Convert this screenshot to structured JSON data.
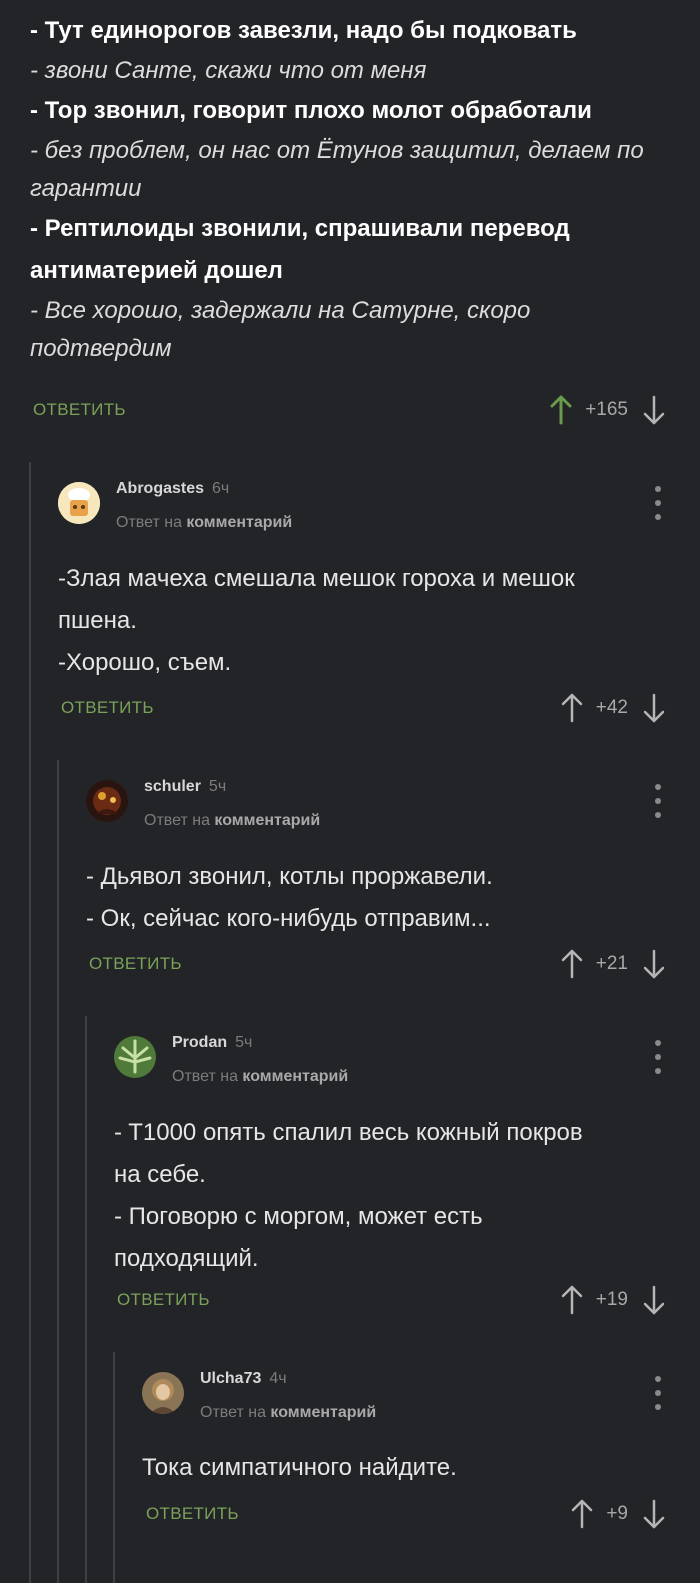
{
  "top_comment": {
    "lines": [
      {
        "text": "- Тут единорогов завезли, надо бы подковать",
        "style": "bold"
      },
      {
        "text": "- звони Санте, скажи что от меня",
        "style": "italic"
      },
      {
        "text": "- Тор звонил, говорит плохо молот обработали",
        "style": "bold"
      },
      {
        "text": "- без проблем, он нас от Ётунов защитил, делаем по",
        "style": "italic"
      },
      {
        "text": "гарантии",
        "style": "italic"
      },
      {
        "text": "- Рептилоиды звонили, спрашивали перевод",
        "style": "bold"
      },
      {
        "text": "антиматерией дошел",
        "style": "bold"
      },
      {
        "text": "- Все хорошо, задержали на Сатурне, скоро",
        "style": "italic"
      },
      {
        "text": "подтвердим",
        "style": "italic"
      }
    ],
    "reply_label": "ОТВЕТИТЬ",
    "rating": "+165"
  },
  "comments": [
    {
      "author": "Abrogastes",
      "time": "6ч",
      "reply_prefix": "Ответ на",
      "reply_target": "комментарий",
      "body": [
        "-Злая мачеха смешала мешок гороха и мешок",
        "пшена.",
        "-Хорошо, съем."
      ],
      "reply_label": "ОТВЕТИТЬ",
      "rating": "+42"
    },
    {
      "author": "schuler",
      "time": "5ч",
      "reply_prefix": "Ответ на",
      "reply_target": "комментарий",
      "body": [
        "- Дьявол звонил, котлы проржавели.",
        "- Ок, сейчас кого-нибудь отправим..."
      ],
      "reply_label": "ОТВЕТИТЬ",
      "rating": "+21"
    },
    {
      "author": "Prodan",
      "time": "5ч",
      "reply_prefix": "Ответ на",
      "reply_target": "комментарий",
      "body": [
        "- T1000 опять спалил весь кожный покров",
        "на себе.",
        "- Поговорю с моргом, может есть",
        "подходящий."
      ],
      "reply_label": "ОТВЕТИТЬ",
      "rating": "+19"
    },
    {
      "author": "Ulcha73",
      "time": "4ч",
      "reply_prefix": "Ответ на",
      "reply_target": "комментарий",
      "body": [
        "Тока симпатичного найдите."
      ],
      "reply_label": "ОТВЕТИТЬ",
      "rating": "+9"
    }
  ],
  "colors": {
    "background": "#232427",
    "reply_green": "#7aa25a",
    "upvote_active": "#6a9a4a",
    "thread_line": "#3d3f44"
  }
}
